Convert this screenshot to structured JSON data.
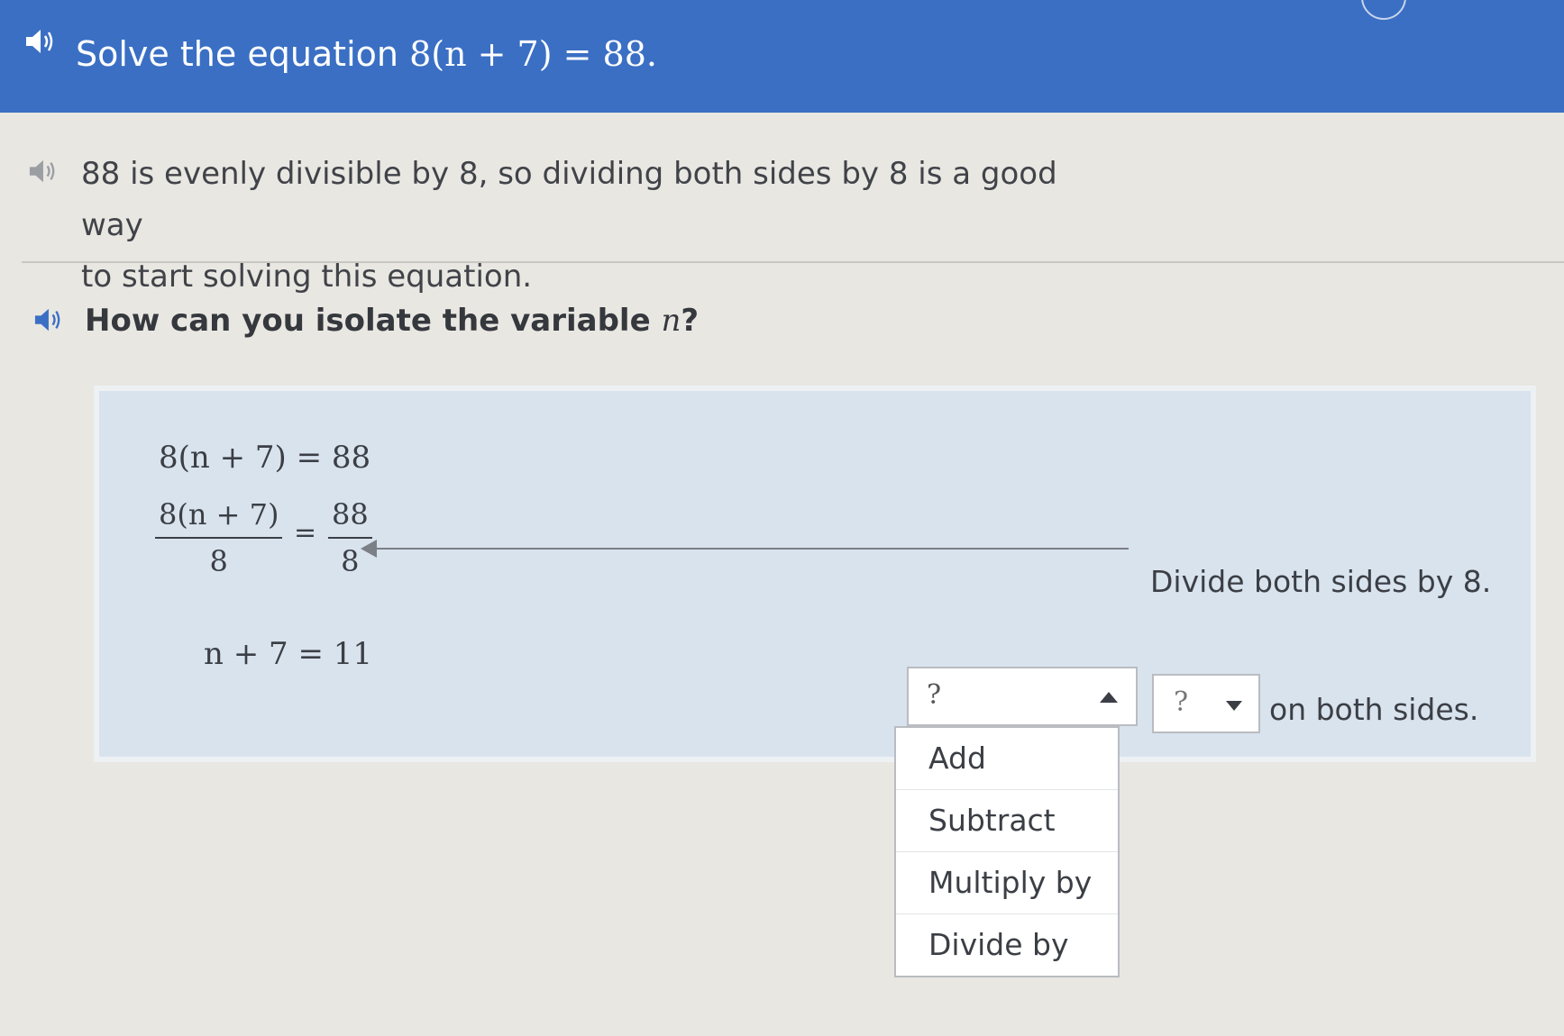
{
  "header": {
    "title_prefix": "Solve the equation ",
    "equation": "8(n + 7) = 88."
  },
  "hint": {
    "line1": "88 is evenly divisible by 8, so dividing both sides by 8 is a good way",
    "line2": "to start solving this equation."
  },
  "question": {
    "text": "How can you isolate the variable ",
    "variable": "n",
    "end": "?"
  },
  "work": {
    "eq1": "8(n + 7) = 88",
    "frac_left_num": "8(n + 7)",
    "frac_left_den": "8",
    "frac_equals": "=",
    "frac_right_num": "88",
    "frac_right_den": "8",
    "eq3": "n + 7 = 11",
    "step1_label": "Divide both sides by 8.",
    "operation_select_value": "?",
    "number_select_value": "?",
    "step2_suffix": "on both sides."
  },
  "dropdown": {
    "options": [
      "Add",
      "Subtract",
      "Multiply by",
      "Divide by"
    ]
  },
  "icons": {
    "speaker": "speaker-icon",
    "caret_up": "caret-up-icon",
    "caret_down": "caret-down-icon"
  },
  "colors": {
    "header_bg": "#3a6fc4",
    "panel_bg": "#d9e3ee",
    "page_bg": "#e9e7e2"
  }
}
